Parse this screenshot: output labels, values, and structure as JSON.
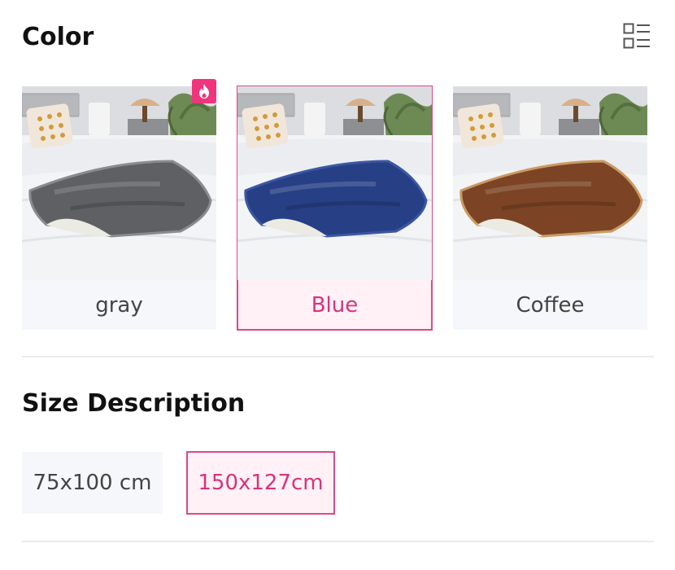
{
  "color_section": {
    "title": "Color",
    "options": [
      {
        "label": "gray",
        "blanket_color": "#5f6064",
        "trim_color": "#8a8b8e",
        "selected": false,
        "hot": true
      },
      {
        "label": "Blue",
        "blanket_color": "#273f85",
        "trim_color": "#3b57a3",
        "selected": true,
        "hot": false
      },
      {
        "label": "Coffee",
        "blanket_color": "#7c4424",
        "trim_color": "#c99a63",
        "selected": false,
        "hot": false
      }
    ]
  },
  "size_section": {
    "title": "Size Description",
    "options": [
      {
        "label": "75x100 cm",
        "selected": false
      },
      {
        "label": "150x127cm",
        "selected": true
      }
    ]
  },
  "colors": {
    "accent": "#e0468a",
    "accent_text": "#d8337b",
    "selected_bg": "#fff1f6",
    "chip_bg": "#f6f7fa",
    "badge": "#f0347d"
  },
  "icons": {
    "view_toggle": "list-grid-icon",
    "badge": "fire-icon",
    "zoom": "expand-icon"
  }
}
